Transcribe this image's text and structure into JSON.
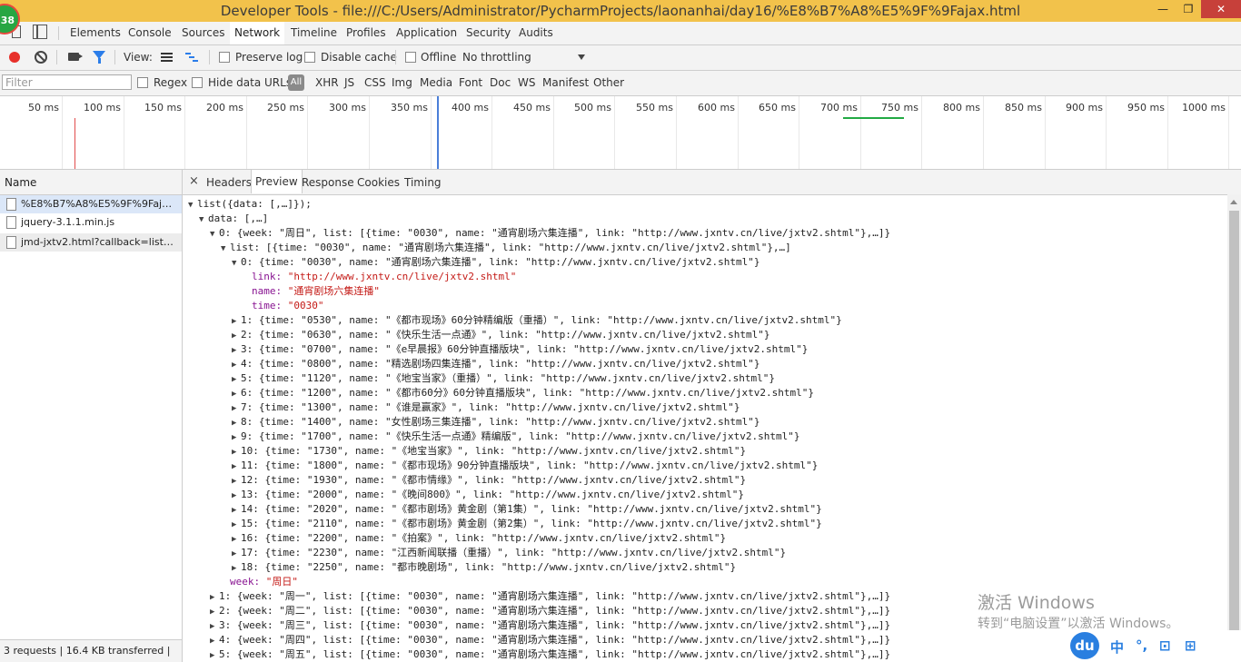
{
  "window": {
    "title": "Developer Tools - file:///C:/Users/Administrator/PycharmProjects/laonanhai/day16/%E8%B7%A8%E5%9F%9Fajax.html",
    "badge": "38",
    "controls": {
      "minimize": "—",
      "restore": "❐",
      "close": "✕"
    }
  },
  "main_tabs": [
    "Elements",
    "Console",
    "Sources",
    "Network",
    "Timeline",
    "Profiles",
    "Application",
    "Security",
    "Audits"
  ],
  "main_tab_active": "Network",
  "toolbar": {
    "view_label": "View:",
    "preserve_log": "Preserve log",
    "disable_cache": "Disable cache",
    "offline": "Offline",
    "throttling": "No throttling"
  },
  "filterbar": {
    "placeholder": "Filter",
    "regex": "Regex",
    "hide_data_urls": "Hide data URLs",
    "all": "All",
    "types": [
      "XHR",
      "JS",
      "CSS",
      "Img",
      "Media",
      "Font",
      "Doc",
      "WS",
      "Manifest",
      "Other"
    ]
  },
  "timeline_ticks": [
    "50 ms",
    "100 ms",
    "150 ms",
    "200 ms",
    "250 ms",
    "300 ms",
    "350 ms",
    "400 ms",
    "450 ms",
    "500 ms",
    "550 ms",
    "600 ms",
    "650 ms",
    "700 ms",
    "750 ms",
    "800 ms",
    "850 ms",
    "900 ms",
    "950 ms",
    "1000 ms"
  ],
  "requests": {
    "header": "Name",
    "items": [
      "%E8%B7%A8%E5%9F%9Fajax.html",
      "jquery-3.1.1.min.js",
      "jmd-jxtv2.html?callback=list&_=1..."
    ],
    "status": "3 requests  |  16.4 KB transferred  |"
  },
  "detail": {
    "close": "×",
    "tabs": [
      "Headers",
      "Preview",
      "Response",
      "Cookies",
      "Timing"
    ],
    "active": "Preview"
  },
  "tree": {
    "root": "list({data: [,…]});",
    "data_line": "data: [,…]",
    "week0": "0: {week: \"周日\", list: [{time: \"0030\", name: \"通宵剧场六集连播\", link: \"http://www.jxntv.cn/live/jxtv2.shtml\"},…]}",
    "list_line": "list: [{time: \"0030\", name: \"通宵剧场六集连播\", link: \"http://www.jxntv.cn/live/jxtv2.shtml\"},…]",
    "item0": "0: {time: \"0030\", name: \"通宵剧场六集连播\", link: \"http://www.jxntv.cn/live/jxtv2.shtml\"}",
    "item0_props": [
      {
        "k": "link",
        "v": "\"http://www.jxntv.cn/live/jxtv2.shtml\""
      },
      {
        "k": "name",
        "v": "\"通宵剧场六集连播\""
      },
      {
        "k": "time",
        "v": "\"0030\""
      }
    ],
    "items": [
      "1: {time: \"0530\", name: \"《都市现场》60分钟精编版（重播）\", link: \"http://www.jxntv.cn/live/jxtv2.shtml\"}",
      "2: {time: \"0630\", name: \"《快乐生活一点通》\", link: \"http://www.jxntv.cn/live/jxtv2.shtml\"}",
      "3: {time: \"0700\", name: \"《e早晨报》60分钟直播版块\", link: \"http://www.jxntv.cn/live/jxtv2.shtml\"}",
      "4: {time: \"0800\", name: \"精选剧场四集连播\", link: \"http://www.jxntv.cn/live/jxtv2.shtml\"}",
      "5: {time: \"1120\", name: \"《地宝当家》（重播）\", link: \"http://www.jxntv.cn/live/jxtv2.shtml\"}",
      "6: {time: \"1200\", name: \"《都市60分》60分钟直播版块\", link: \"http://www.jxntv.cn/live/jxtv2.shtml\"}",
      "7: {time: \"1300\", name: \"《谁是赢家》\", link: \"http://www.jxntv.cn/live/jxtv2.shtml\"}",
      "8: {time: \"1400\", name: \"女性剧场三集连播\", link: \"http://www.jxntv.cn/live/jxtv2.shtml\"}",
      "9: {time: \"1700\", name: \"《快乐生活一点通》精编版\", link: \"http://www.jxntv.cn/live/jxtv2.shtml\"}",
      "10: {time: \"1730\", name: \"《地宝当家》\", link: \"http://www.jxntv.cn/live/jxtv2.shtml\"}",
      "11: {time: \"1800\", name: \"《都市现场》90分钟直播版块\", link: \"http://www.jxntv.cn/live/jxtv2.shtml\"}",
      "12: {time: \"1930\", name: \"《都市情缘》\", link: \"http://www.jxntv.cn/live/jxtv2.shtml\"}",
      "13: {time: \"2000\", name: \"《晚间800》\", link: \"http://www.jxntv.cn/live/jxtv2.shtml\"}",
      "14: {time: \"2020\", name: \"《都市剧场》黄金剧（第1集）\", link: \"http://www.jxntv.cn/live/jxtv2.shtml\"}",
      "15: {time: \"2110\", name: \"《都市剧场》黄金剧（第2集）\", link: \"http://www.jxntv.cn/live/jxtv2.shtml\"}",
      "16: {time: \"2200\", name: \"《拍案》\", link: \"http://www.jxntv.cn/live/jxtv2.shtml\"}",
      "17: {time: \"2230\", name: \"江西新闻联播（重播）\", link: \"http://www.jxntv.cn/live/jxtv2.shtml\"}",
      "18: {time: \"2250\", name: \"都市晚剧场\", link: \"http://www.jxntv.cn/live/jxtv2.shtml\"}"
    ],
    "week_prop": {
      "k": "week",
      "v": "\"周日\""
    },
    "weeks": [
      "1: {week: \"周一\", list: [{time: \"0030\", name: \"通宵剧场六集连播\", link: \"http://www.jxntv.cn/live/jxtv2.shtml\"},…]}",
      "2: {week: \"周二\", list: [{time: \"0030\", name: \"通宵剧场六集连播\", link: \"http://www.jxntv.cn/live/jxtv2.shtml\"},…]}",
      "3: {week: \"周三\", list: [{time: \"0030\", name: \"通宵剧场六集连播\", link: \"http://www.jxntv.cn/live/jxtv2.shtml\"},…]}",
      "4: {week: \"周四\", list: [{time: \"0030\", name: \"通宵剧场六集连播\", link: \"http://www.jxntv.cn/live/jxtv2.shtml\"},…]}",
      "5: {week: \"周五\", list: [{time: \"0030\", name: \"通宵剧场六集连播\", link: \"http://www.jxntv.cn/live/jxtv2.shtml\"},…]}"
    ]
  },
  "watermark": {
    "line1": "激活 Windows",
    "line2": "转到“电脑设置”以激活 Windows。"
  },
  "ime": {
    "logo": "du",
    "chars": [
      "中",
      "°,",
      "⊡",
      "⊞"
    ]
  },
  "colors": {
    "titlebar": "#f2c24b",
    "accent": "#2b7de9",
    "record": "#e7302a",
    "key": "#881391",
    "string": "#c41a16"
  }
}
